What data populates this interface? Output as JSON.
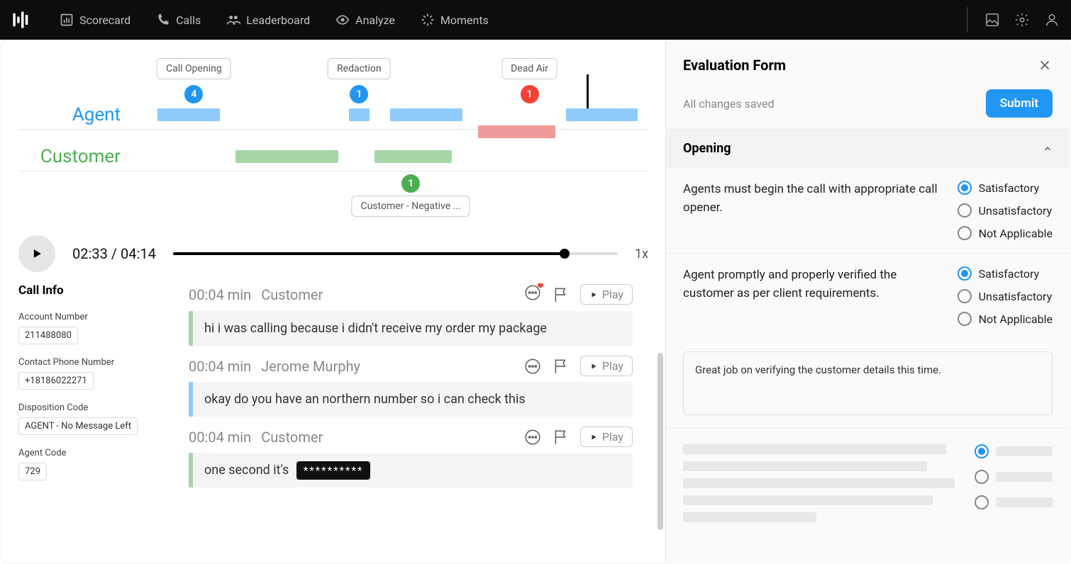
{
  "nav": {
    "items": [
      {
        "label": "Scorecard"
      },
      {
        "label": "Calls"
      },
      {
        "label": "Leaderboard"
      },
      {
        "label": "Analyze"
      },
      {
        "label": "Moments"
      }
    ]
  },
  "timeline": {
    "agent_label": "Agent",
    "customer_label": "Customer",
    "markers": {
      "call_opening": {
        "label": "Call Opening",
        "count": "4"
      },
      "redaction": {
        "label": "Redaction",
        "count": "1"
      },
      "dead_air": {
        "label": "Dead Air",
        "count": "1"
      },
      "cust_neg": {
        "label": "Customer - Negative ...",
        "count": "1"
      }
    }
  },
  "player": {
    "current": "02:33",
    "total": "04:14",
    "speed": "1x"
  },
  "call_info": {
    "title": "Call Info",
    "account_label": "Account Number",
    "account_value": "211488080",
    "phone_label": "Contact Phone Number",
    "phone_value": "+18186022271",
    "disp_label": "Disposition Code",
    "disp_value": "AGENT - No Message Left",
    "agentcode_label": "Agent Code",
    "agentcode_value": "729"
  },
  "transcript": [
    {
      "time": "00:04 min",
      "who": "Customer",
      "text": "hi i was calling because i didn't receive my order my package",
      "kind": "cust",
      "notif": true
    },
    {
      "time": "00:04 min",
      "who": "Jerome Murphy",
      "text": "okay do you have an northern number so i can check this",
      "kind": "agent",
      "notif": false
    },
    {
      "time": "00:04 min",
      "who": "Customer",
      "text": "one second it's",
      "kind": "cust",
      "redacted": "**********",
      "notif": false
    }
  ],
  "play_chip": "Play",
  "eval": {
    "title": "Evaluation Form",
    "saved": "All changes saved",
    "submit": "Submit",
    "section": "Opening",
    "q1": "Agents must begin the call with appropriate call opener.",
    "q2": "Agent promptly and properly verified the customer as per client requirements.",
    "opts": {
      "sat": "Satisfactory",
      "unsat": "Unsatisfactory",
      "na": "Not Applicable"
    },
    "comment": "Great job on verifying the customer details this time."
  }
}
